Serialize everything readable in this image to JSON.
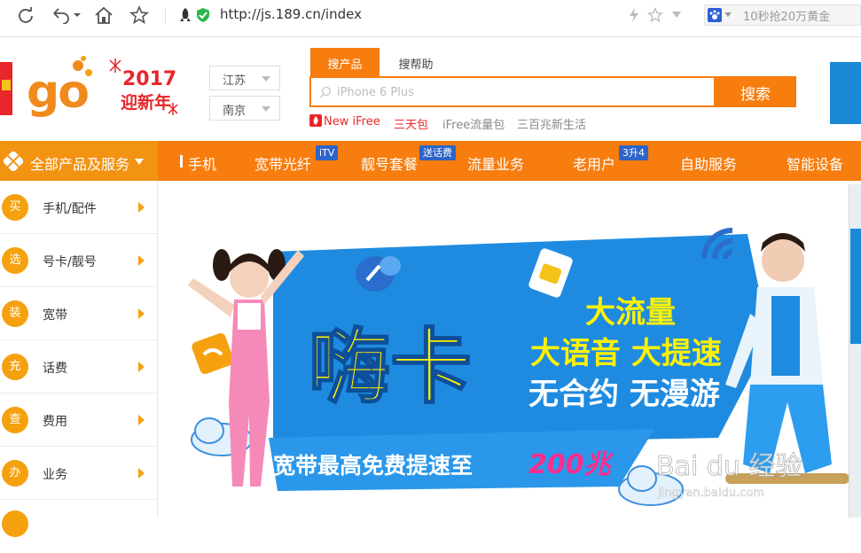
{
  "browser": {
    "url": "http://js.189.cn/index",
    "extension_text": "10秒抢20万黄金"
  },
  "header": {
    "logo_text": "go",
    "newyear_year": "2017",
    "newyear_text": "迎新年",
    "province": "江苏",
    "city": "南京"
  },
  "search": {
    "tabs": [
      "搜产品",
      "搜帮助"
    ],
    "placeholder": "iPhone 6 Plus",
    "button": "搜索",
    "hot_links": [
      "New iFree",
      "三天包",
      "iFree流量包",
      "三百兆新生活"
    ]
  },
  "nav": {
    "all_products": "全部产品及服务",
    "items": [
      "手机",
      "宽带光纤",
      "靓号套餐",
      "流量业务",
      "老用户",
      "自助服务",
      "智能设备"
    ],
    "badges": [
      "iTV",
      "送话费",
      "3升4"
    ]
  },
  "sidebar": {
    "items": [
      {
        "icon": "买",
        "label": "手机/配件"
      },
      {
        "icon": "选",
        "label": "号卡/靓号"
      },
      {
        "icon": "装",
        "label": "宽带"
      },
      {
        "icon": "充",
        "label": "话费"
      },
      {
        "icon": "查",
        "label": "费用"
      },
      {
        "icon": "办",
        "label": "业务"
      }
    ]
  },
  "hero": {
    "title": "嗨卡",
    "line1": "大流量",
    "line2": "大语音 大提速",
    "line3": "无合约 无漫游",
    "bottom": "宽带最高免费提速至",
    "bottom_highlight": "200兆",
    "watermark": "Bai du 经验",
    "watermark_url": "jingyan.baidu.com"
  },
  "colors": {
    "orange": "#f77d0f",
    "hero_blue": "#1f8be0",
    "hero_yellow": "#fff200"
  }
}
